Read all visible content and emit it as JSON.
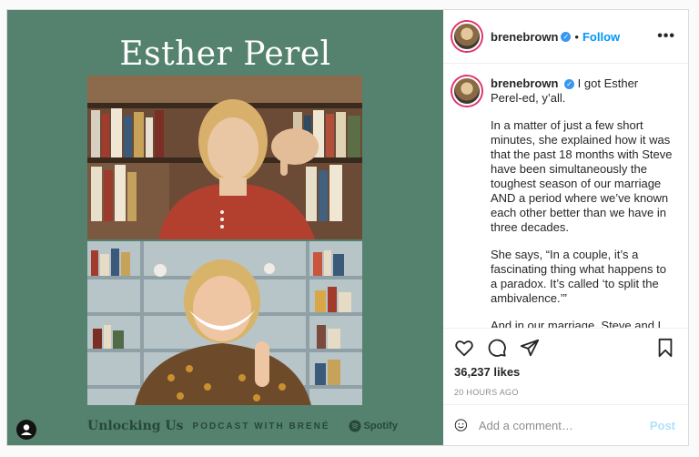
{
  "media": {
    "title": "Esther Perel",
    "brand": "Unlocking Us",
    "podcast_text": "PODCAST WITH BRENÉ",
    "spotify_label": "Spotify",
    "background_color": "#54826e"
  },
  "header": {
    "username": "brenebrown",
    "verified_icon": "verified-badge-icon",
    "separator": "•",
    "follow_label": "Follow",
    "more_label": "•••"
  },
  "caption": {
    "username": "brenebrown",
    "first_line": "I got Esther Perel-ed, y’all.",
    "paragraphs": [
      "In a matter of just a few short minutes, she explained how it was that the past 18 months with Steve have been simultaneously the toughest season of our marriage AND a period where we’ve known each other better than we have in three decades.",
      "She says, “In a couple, it’s a fascinating thing what happens to a paradox. It’s called ‘to split the ambivalence.’”",
      "And in our marriage, Steve and I have been splitting the ambivalence over uncertainty. And the struggle of the"
    ]
  },
  "actions": {
    "icons": [
      "heart-icon",
      "comment-icon",
      "share-icon",
      "bookmark-icon"
    ],
    "likes": "36,237 likes",
    "timestamp": "20 HOURS AGO"
  },
  "comment_box": {
    "emoji_icon": "emoji-icon",
    "placeholder": "Add a comment…",
    "post_label": "Post"
  }
}
